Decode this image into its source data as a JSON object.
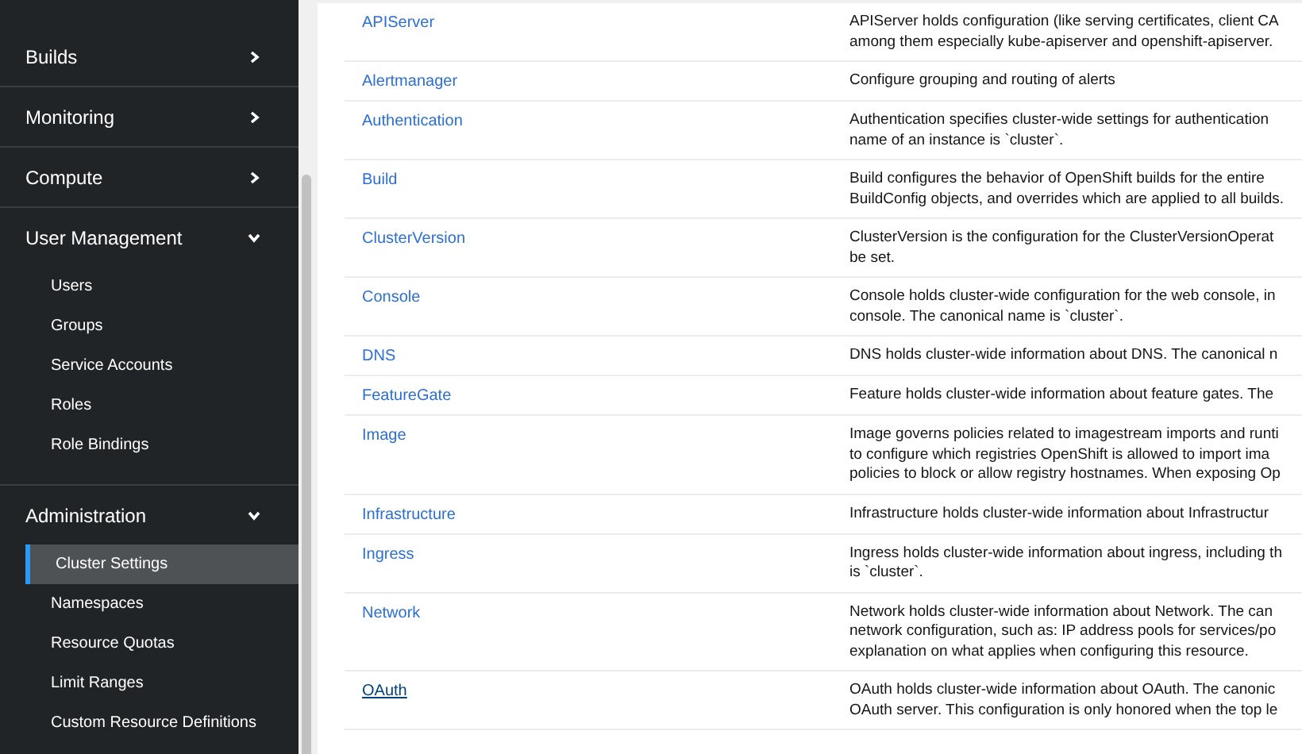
{
  "sidebar": {
    "sections": [
      {
        "label": "Builds",
        "expanded": false
      },
      {
        "label": "Monitoring",
        "expanded": false
      },
      {
        "label": "Compute",
        "expanded": false
      },
      {
        "label": "User Management",
        "expanded": true,
        "items": [
          {
            "label": "Users",
            "selected": false
          },
          {
            "label": "Groups",
            "selected": false
          },
          {
            "label": "Service Accounts",
            "selected": false
          },
          {
            "label": "Roles",
            "selected": false
          },
          {
            "label": "Role Bindings",
            "selected": false
          }
        ]
      },
      {
        "label": "Administration",
        "expanded": true,
        "items": [
          {
            "label": "Cluster Settings",
            "selected": true
          },
          {
            "label": "Namespaces",
            "selected": false
          },
          {
            "label": "Resource Quotas",
            "selected": false
          },
          {
            "label": "Limit Ranges",
            "selected": false
          },
          {
            "label": "Custom Resource Definitions",
            "selected": false
          }
        ]
      }
    ]
  },
  "table": {
    "rows": [
      {
        "name": "APIServer",
        "hovered": false,
        "description": [
          "APIServer holds configuration (like serving certificates, client CA",
          "among them especially kube-apiserver and openshift-apiserver."
        ]
      },
      {
        "name": "Alertmanager",
        "hovered": false,
        "description": [
          "Configure grouping and routing of alerts"
        ]
      },
      {
        "name": "Authentication",
        "hovered": false,
        "description": [
          "Authentication specifies cluster-wide settings for authentication",
          "name of an instance is `cluster`."
        ]
      },
      {
        "name": "Build",
        "hovered": false,
        "description": [
          "Build configures the behavior of OpenShift builds for the entire",
          "BuildConfig objects, and overrides which are applied to all builds."
        ]
      },
      {
        "name": "ClusterVersion",
        "hovered": false,
        "description": [
          "ClusterVersion is the configuration for the ClusterVersionOperat",
          "be set."
        ]
      },
      {
        "name": "Console",
        "hovered": false,
        "description": [
          "Console holds cluster-wide configuration for the web console, in",
          "console. The canonical name is `cluster`."
        ]
      },
      {
        "name": "DNS",
        "hovered": false,
        "description": [
          "DNS holds cluster-wide information about DNS. The canonical n"
        ]
      },
      {
        "name": "FeatureGate",
        "hovered": false,
        "description": [
          "Feature holds cluster-wide information about feature gates. The"
        ]
      },
      {
        "name": "Image",
        "hovered": false,
        "description": [
          "Image governs policies related to imagestream imports and runti",
          "to configure which registries OpenShift is allowed to import ima",
          "policies to block or allow registry hostnames. When exposing Op"
        ]
      },
      {
        "name": "Infrastructure",
        "hovered": false,
        "description": [
          "Infrastructure holds cluster-wide information about Infrastructur"
        ]
      },
      {
        "name": "Ingress",
        "hovered": false,
        "description": [
          "Ingress holds cluster-wide information about ingress, including th",
          "is `cluster`."
        ]
      },
      {
        "name": "Network",
        "hovered": false,
        "description": [
          "Network holds cluster-wide information about Network. The can",
          "network configuration, such as: IP address pools for services/po",
          "explanation on what applies when configuring this resource."
        ]
      },
      {
        "name": "OAuth",
        "hovered": true,
        "description": [
          "OAuth holds cluster-wide information about OAuth. The canonic",
          "OAuth server. This configuration is only honored when the top le"
        ]
      }
    ]
  }
}
